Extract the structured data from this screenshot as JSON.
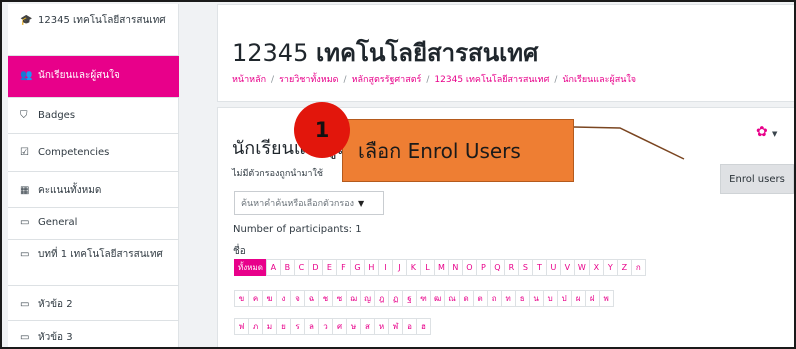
{
  "sidebar": {
    "items": [
      {
        "icon": "graduation-cap-icon",
        "glyph": "🎓",
        "label": "12345 เทคโนโลยีสารสนเทศ"
      },
      {
        "icon": "users-icon",
        "glyph": "👥",
        "label": "นักเรียนและผู้สนใจ"
      },
      {
        "icon": "shield-icon",
        "glyph": "⛉",
        "label": "Badges"
      },
      {
        "icon": "checkbox-icon",
        "glyph": "☑",
        "label": "Competencies"
      },
      {
        "icon": "table-icon",
        "glyph": "▦",
        "label": "คะแนนทั้งหมด"
      },
      {
        "icon": "folder-icon",
        "glyph": "▭",
        "label": "General"
      },
      {
        "icon": "folder-icon",
        "glyph": "▭",
        "label": "บทที่ 1 เทคโนโลยีสารสนเทศ"
      },
      {
        "icon": "folder-icon",
        "glyph": "▭",
        "label": "หัวข้อ 2"
      },
      {
        "icon": "folder-icon",
        "glyph": "▭",
        "label": "หัวข้อ 3"
      }
    ]
  },
  "header": {
    "course_number": "12345",
    "course_name": "เทคโนโลยีสารสนเทศ",
    "breadcrumb": [
      "หน้าหลัก",
      "รายวิชาทั้งหมด",
      "หลักสูตรรัฐศาสตร์",
      "12345 เทคโนโลยีสารสนเทศ",
      "นักเรียนและผู้สนใจ"
    ],
    "breadcrumb_sep": "/"
  },
  "participants": {
    "section_title": "นักเรียนและผู้สนใจ",
    "no_filter_text": "ไม่มีตัวกรองถูกนำมาใช้",
    "enrol_button": "Enrol users",
    "gear_icon": "gear-icon",
    "search_placeholder": "ค้นหาคำค้นหรือเลือกตัวกรอง",
    "count_text": "Number of participants: 1",
    "first_name_label": "ชื่อ",
    "alpha_row1": [
      "ทั้งหมด",
      "A",
      "B",
      "C",
      "D",
      "E",
      "F",
      "G",
      "H",
      "I",
      "J",
      "K",
      "L",
      "M",
      "N",
      "O",
      "P",
      "Q",
      "R",
      "S",
      "T",
      "U",
      "V",
      "W",
      "X",
      "Y",
      "Z",
      "ก"
    ],
    "alpha_row2": [
      "ข",
      "ค",
      "ฆ",
      "ง",
      "จ",
      "ฉ",
      "ช",
      "ซ",
      "ฌ",
      "ญ",
      "ฎ",
      "ฏ",
      "ฐ",
      "ฑ",
      "ฒ",
      "ณ",
      "ด",
      "ต",
      "ถ",
      "ท",
      "ธ",
      "น",
      "บ",
      "ป",
      "ผ",
      "ฝ",
      "พ"
    ],
    "alpha_row3": [
      "ฟ",
      "ภ",
      "ม",
      "ย",
      "ร",
      "ล",
      "ว",
      "ศ",
      "ษ",
      "ส",
      "ห",
      "ฬ",
      "อ",
      "ฮ"
    ]
  },
  "annotation": {
    "step_number": "1",
    "callout_text": "เลือก Enrol Users"
  },
  "colors": {
    "accent": "#e8008a",
    "callout": "#ee7e33",
    "badge": "#e2160c"
  }
}
